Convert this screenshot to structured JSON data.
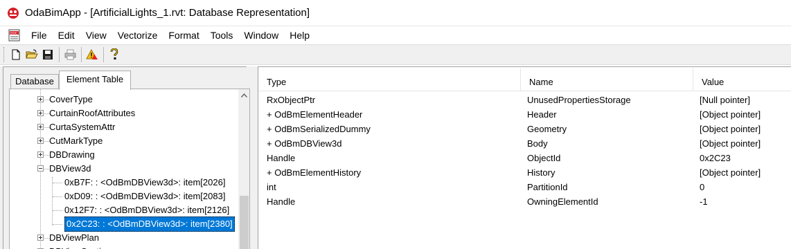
{
  "window": {
    "title": "OdaBimApp - [ArtificialLights_1.rvt: Database Representation]"
  },
  "menu": {
    "items": [
      "File",
      "Edit",
      "View",
      "Vectorize",
      "Format",
      "Tools",
      "Window",
      "Help"
    ]
  },
  "toolbar": {
    "buttons": [
      "new-document-icon",
      "open-folder-icon",
      "save-disk-icon",
      "print-icon",
      "warning-icon",
      "help-question-icon"
    ]
  },
  "left": {
    "tabs": [
      "Database",
      "Element Table"
    ],
    "tree": [
      {
        "label": "CoverType",
        "expander": "plus"
      },
      {
        "label": "CurtainRoofAttributes",
        "expander": "plus"
      },
      {
        "label": "CurtaSystemAttr",
        "expander": "plus"
      },
      {
        "label": "CutMarkType",
        "expander": "plus"
      },
      {
        "label": "DBDrawing",
        "expander": "plus"
      },
      {
        "label": "DBView3d",
        "expander": "minus"
      },
      {
        "label": "0xB7F: : <OdBmDBView3d>: item[2026]",
        "child": true
      },
      {
        "label": "0xD09: : <OdBmDBView3d>: item[2083]",
        "child": true
      },
      {
        "label": "0x12F7: : <OdBmDBView3d>: item[2126]",
        "child": true
      },
      {
        "label": "0x2C23: : <OdBmDBView3d>: item[2380]",
        "child": true,
        "selected": true
      },
      {
        "label": "DBViewPlan",
        "expander": "plus"
      },
      {
        "label": "DBViewSection",
        "expander": "plus"
      }
    ]
  },
  "table": {
    "columns": [
      "Type",
      "Name",
      "Value"
    ],
    "rows": [
      {
        "type": "RxObjectPtr",
        "name": "UnusedPropertiesStorage",
        "value": "[Null pointer]"
      },
      {
        "type": "+ OdBmElementHeader",
        "name": "Header",
        "value": "[Object pointer]"
      },
      {
        "type": "+ OdBmSerializedDummy",
        "name": "Geometry",
        "value": "[Object pointer]"
      },
      {
        "type": "+ OdBmDBView3d",
        "name": "Body",
        "value": "[Object pointer]"
      },
      {
        "type": "Handle",
        "name": "ObjectId",
        "value": " 0x2C23"
      },
      {
        "type": "+ OdBmElementHistory",
        "name": "History",
        "value": "[Object pointer]"
      },
      {
        "type": "int",
        "name": "PartitionId",
        "value": "0"
      },
      {
        "type": "Handle",
        "name": "OwningElementId",
        "value": " -1"
      }
    ]
  },
  "colors": {
    "selection": "#0078d7",
    "app_icon_red": "#d4202a"
  }
}
